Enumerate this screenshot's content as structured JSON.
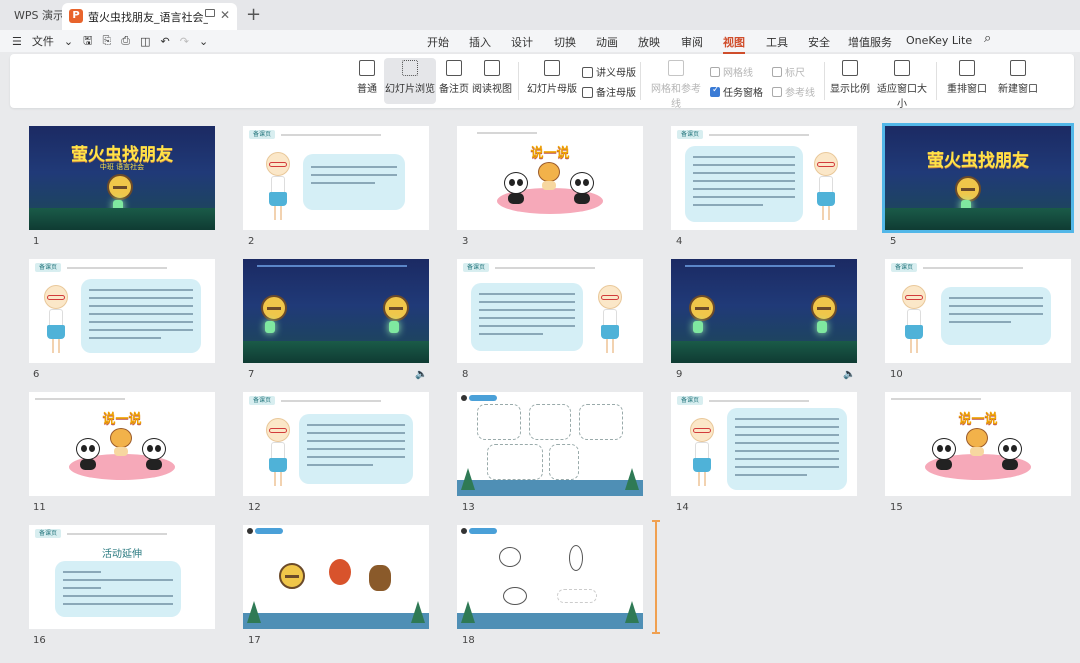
{
  "titlebar": {
    "app_name": "WPS 演示",
    "doc_title": "萤火虫找朋友_语言社会_中班_",
    "new_tab": "+"
  },
  "menu": {
    "file": "文件",
    "tabs": [
      "开始",
      "插入",
      "设计",
      "切换",
      "动画",
      "放映",
      "审阅",
      "视图",
      "工具",
      "安全",
      "增值服务",
      "OneKey Lite"
    ],
    "active_tab": "视图"
  },
  "ribbon": {
    "normal": "普通",
    "slide_sorter": "幻灯片浏览",
    "notes_page": "备注页",
    "reading_view": "阅读视图",
    "slide_master": "幻灯片母版",
    "handout_master": "讲义母版",
    "notes_master": "备注母版",
    "grid_guides": "网格和参考线",
    "gridlines": "网格线",
    "ruler": "标尺",
    "task_pane": "任务窗格",
    "guides": "参考线",
    "zoom": "显示比例",
    "fit_window": "适应窗口大小",
    "arrange_windows": "重排窗口",
    "new_window": "新建窗口"
  },
  "slides": {
    "s1_title": "萤火虫找朋友",
    "s1_sub": "中班 语言社会",
    "s5_title": "萤火虫找朋友",
    "tag": "备课页",
    "shuo": "说一说",
    "s16_heading": "活动延伸",
    "numbers": [
      "1",
      "2",
      "3",
      "4",
      "5",
      "6",
      "7",
      "8",
      "9",
      "10",
      "11",
      "12",
      "13",
      "14",
      "15",
      "16",
      "17",
      "18"
    ]
  },
  "colors": {
    "accent": "#d04e2c",
    "selected_outline": "#52b7e8",
    "bubble": "#d5eff6",
    "night_sky": "#1b2a63"
  }
}
